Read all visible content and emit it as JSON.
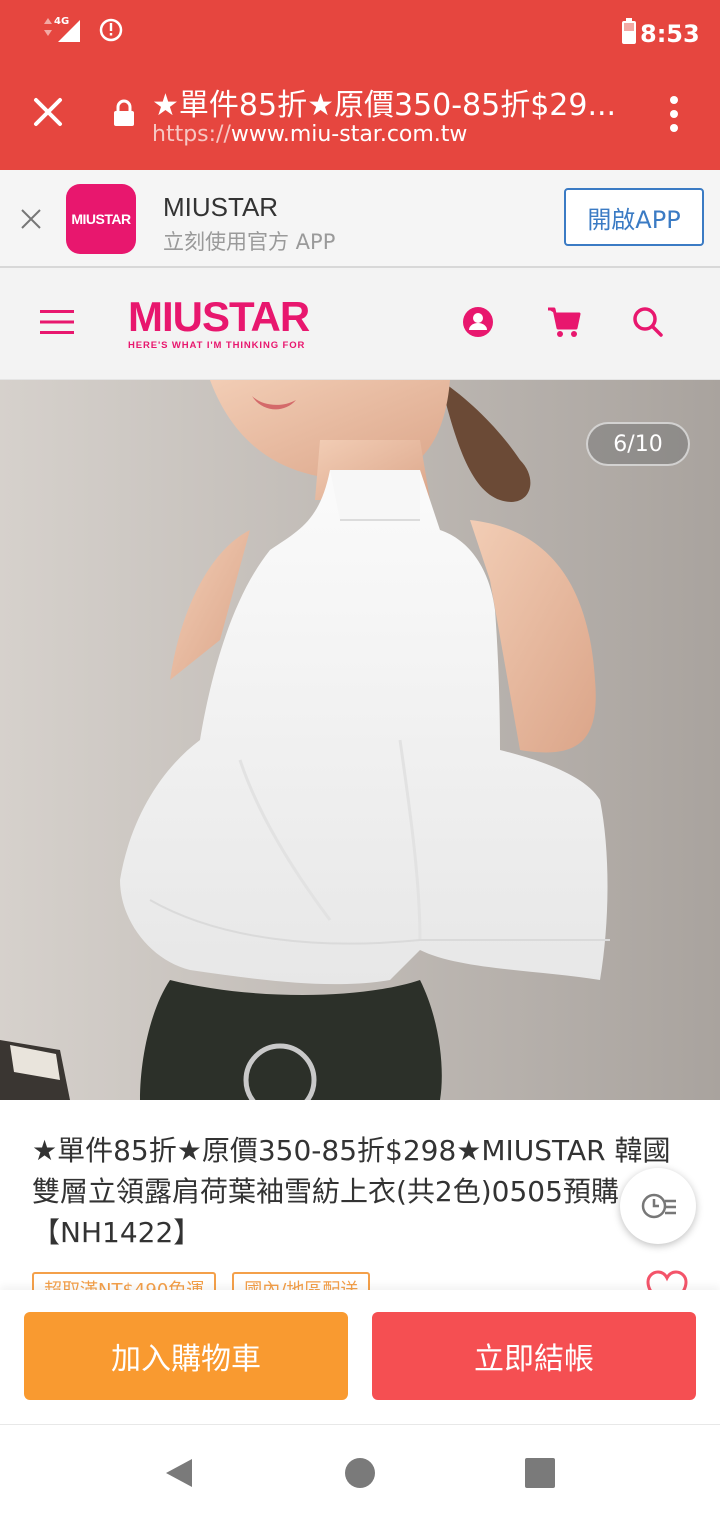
{
  "status_bar": {
    "network": "4G",
    "time": "8:53"
  },
  "browser": {
    "page_title": "★單件85折★原價350-85折$29...",
    "url_scheme": "https://",
    "url_host": "www.miu-star.com.tw"
  },
  "app_banner": {
    "logo_text": "MIUSTAR",
    "app_name": "MIUSTAR",
    "subtitle": "立刻使用官方 APP",
    "open_button": "開啟APP",
    "accent_color": "#3b7bc4"
  },
  "site_header": {
    "logo": "MIUSTAR",
    "tagline": "HERE'S WHAT I'M THINKING FOR",
    "brand_color": "#e8176e",
    "icons": [
      "menu-icon",
      "account-icon",
      "cart-icon",
      "search-icon"
    ]
  },
  "gallery": {
    "counter": "6/10",
    "current": 6,
    "total": 10
  },
  "product": {
    "title": "★單件85折★原價350-85折$298★MIUSTAR 韓國雙層立領露肩荷葉袖雪紡上衣(共2色)0505預購【NH1422】",
    "badges": [
      "超取滿NT$490免運",
      "國內/地區配送"
    ]
  },
  "actions": {
    "add_to_cart": "加入購物車",
    "checkout": "立即結帳",
    "add_color": "#f99a30",
    "checkout_color": "#f54f52"
  },
  "system_nav": [
    "back-icon",
    "home-icon",
    "recents-icon"
  ]
}
